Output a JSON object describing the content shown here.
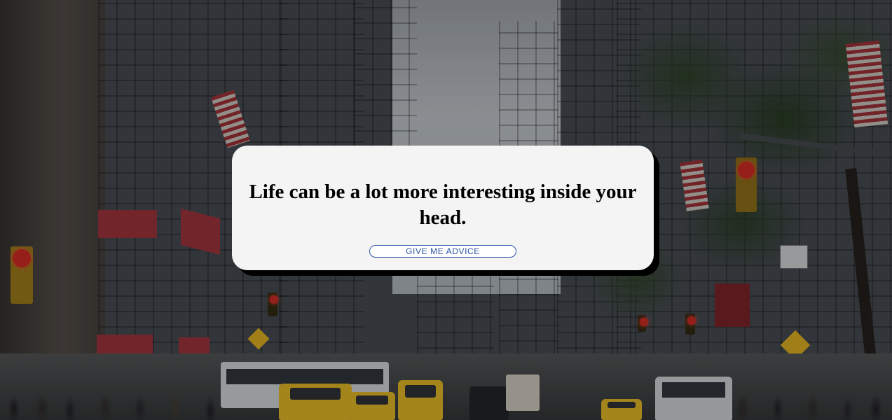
{
  "background": {
    "description_icon": "city-street-photo",
    "overlay_color": "#000000"
  },
  "card": {
    "quote": "Life can be a lot more interesting inside your head.",
    "button_label": "GIVE ME ADVICE",
    "background_color": "#f4f4f4",
    "shadow_color": "#000000",
    "button_color": "#2c54a8"
  }
}
